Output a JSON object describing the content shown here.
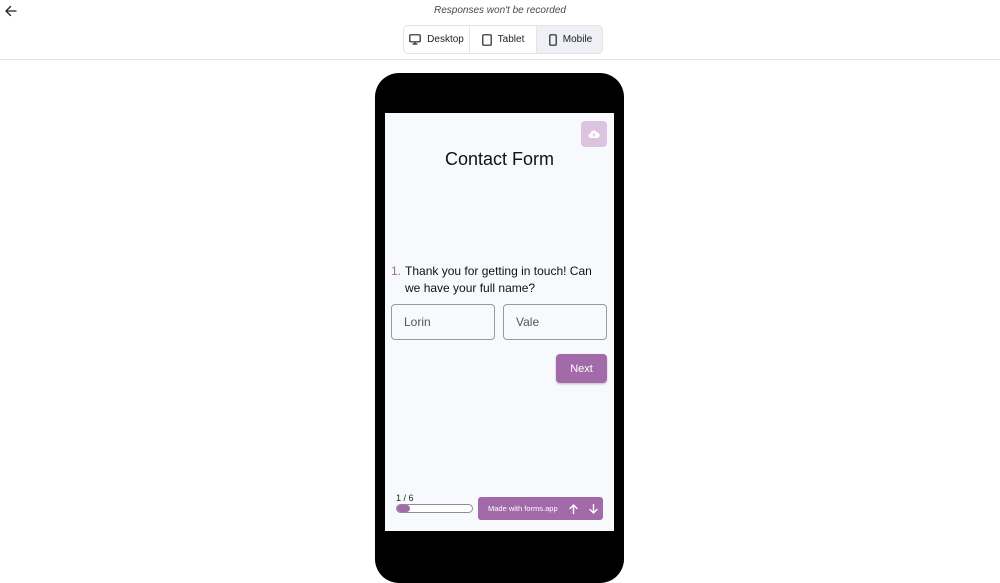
{
  "header": {
    "notice": "Responses won't be recorded",
    "devices": [
      {
        "label": "Desktop",
        "icon": "desktop-icon"
      },
      {
        "label": "Tablet",
        "icon": "tablet-icon"
      },
      {
        "label": "Mobile",
        "icon": "mobile-icon"
      }
    ],
    "active_device": "Mobile"
  },
  "form": {
    "title": "Contact Form",
    "question_number": "1.",
    "question_text": "Thank you for getting in touch! Can we have your full name?",
    "first_name_value": "Lorin",
    "last_name_value": "Vale",
    "next_label": "Next",
    "progress_label": "1 / 6",
    "progress_fraction": 0.1667,
    "brand_text": "Made with forms.app"
  },
  "colors": {
    "accent": "#a26aa8",
    "accent_light": "#dcc3df",
    "phone_frame": "#000000",
    "screen_bg": "#f8f9fc"
  }
}
